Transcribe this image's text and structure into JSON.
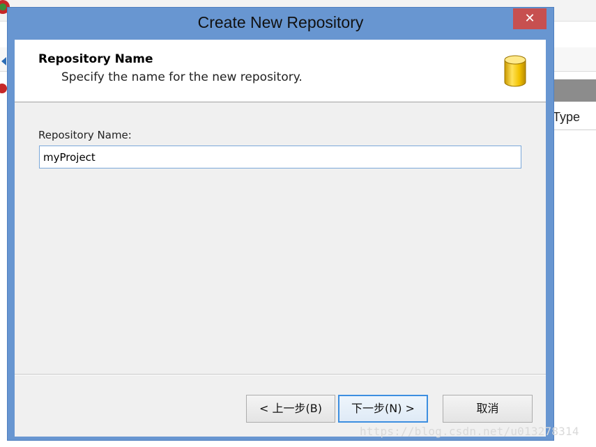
{
  "background_app": {
    "column_header_type": "Type"
  },
  "dialog": {
    "title": "Create New Repository",
    "close_glyph": "✕",
    "header": {
      "title": "Repository Name",
      "subtitle": "Specify the name for the new repository.",
      "icon": "database-icon"
    },
    "form": {
      "name_label": "Repository Name:",
      "name_value": "myProject"
    },
    "buttons": {
      "back": "< 上一步(B)",
      "next": "下一步(N) >",
      "cancel": "取消"
    }
  },
  "watermark": "https://blog.csdn.net/u013278314",
  "colors": {
    "title_bar": "#6896d1",
    "close_button": "#c75050",
    "database_icon": "#f2c200",
    "default_button_border": "#3c8ee0"
  }
}
